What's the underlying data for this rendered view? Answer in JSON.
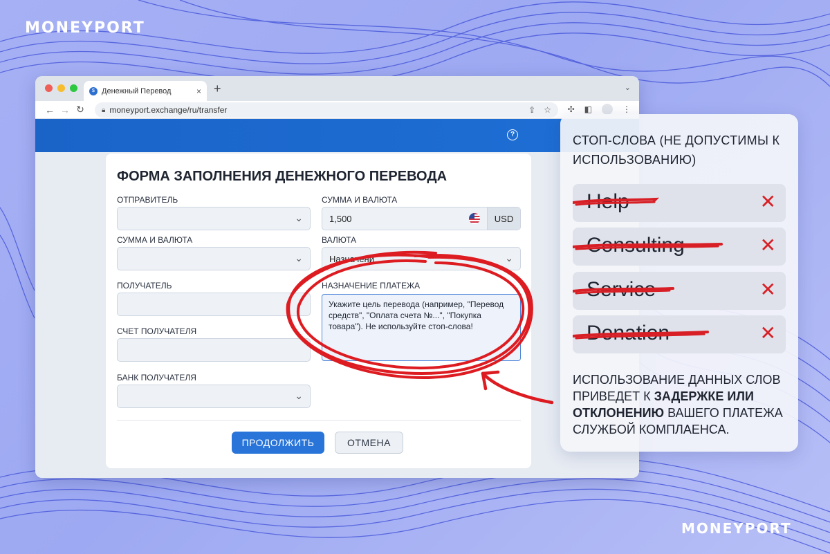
{
  "brand": {
    "logo_top": "MONEYPORT",
    "logo_bottom": "MONEYPORT"
  },
  "browser": {
    "tab_title": "Денежный Перевод",
    "tab_favicon": "$",
    "url": "moneyport.exchange/ru/transfer"
  },
  "form": {
    "title": "ФОРМА ЗАПОЛНЕНИЯ ДЕНЕЖНОГО ПЕРЕВОДА",
    "sender_label": "ОТПРАВИТЕЛЬ",
    "sender_value": "",
    "amount_currency_label_right": "СУММА И ВАЛЮТА",
    "amount_value": "1,500",
    "currency_code": "USD",
    "amount_currency_label_left": "СУММА И ВАЛЮТА",
    "amount_currency_value": "",
    "currency_label": "ВАЛЮТА",
    "currency_value": "Назначени",
    "recipient_label": "ПОЛУЧАТЕЛЬ",
    "recipient_value": "",
    "purpose_label": "НАЗНАЧЕНИЕ ПЛАТЕЖА",
    "purpose_placeholder": "Укажите цель перевода (например, \"Перевод средств\", \"Оплата счета №...\", \"Покупка товара\"). Не используйте стоп-слова!",
    "account_label": "СЧЕТ ПОЛУЧАТЕЛЯ",
    "account_value": "",
    "bank_label": "БАНК ПОЛУЧАТЕЛЯ",
    "bank_value": "",
    "continue_button": "ПРОДОЛЖИТЬ",
    "cancel_button": "ОТМЕНА"
  },
  "stop_words": {
    "title": "СТОП-СЛОВА (НЕ ДОПУСТИМЫ К ИСПОЛЬЗОВАНИЮ)",
    "items": [
      "Help",
      "Consulting",
      "Service",
      "Donation"
    ],
    "warning_part1": "ИСПОЛЬЗОВАНИЕ ДАННЫХ СЛОВ ПРИВЕДЕТ К ",
    "warning_bold": "ЗАДЕРЖКЕ ИЛИ ОТКЛОНЕНИЮ",
    "warning_part2": " ВАШЕГО ПЛАТЕЖА СЛУЖБОЙ КОМПЛАЕНСА."
  },
  "colors": {
    "accent": "#2874d8",
    "header": "#1a64c8",
    "strike": "#d81f26",
    "background": "#a6b0f4"
  },
  "icons": [
    "help-icon",
    "lock-icon",
    "share-icon",
    "star-icon",
    "extensions-icon",
    "sidebar-icon",
    "menu-icon",
    "chevron-down-icon",
    "us-flag-icon",
    "close-x-icon"
  ]
}
